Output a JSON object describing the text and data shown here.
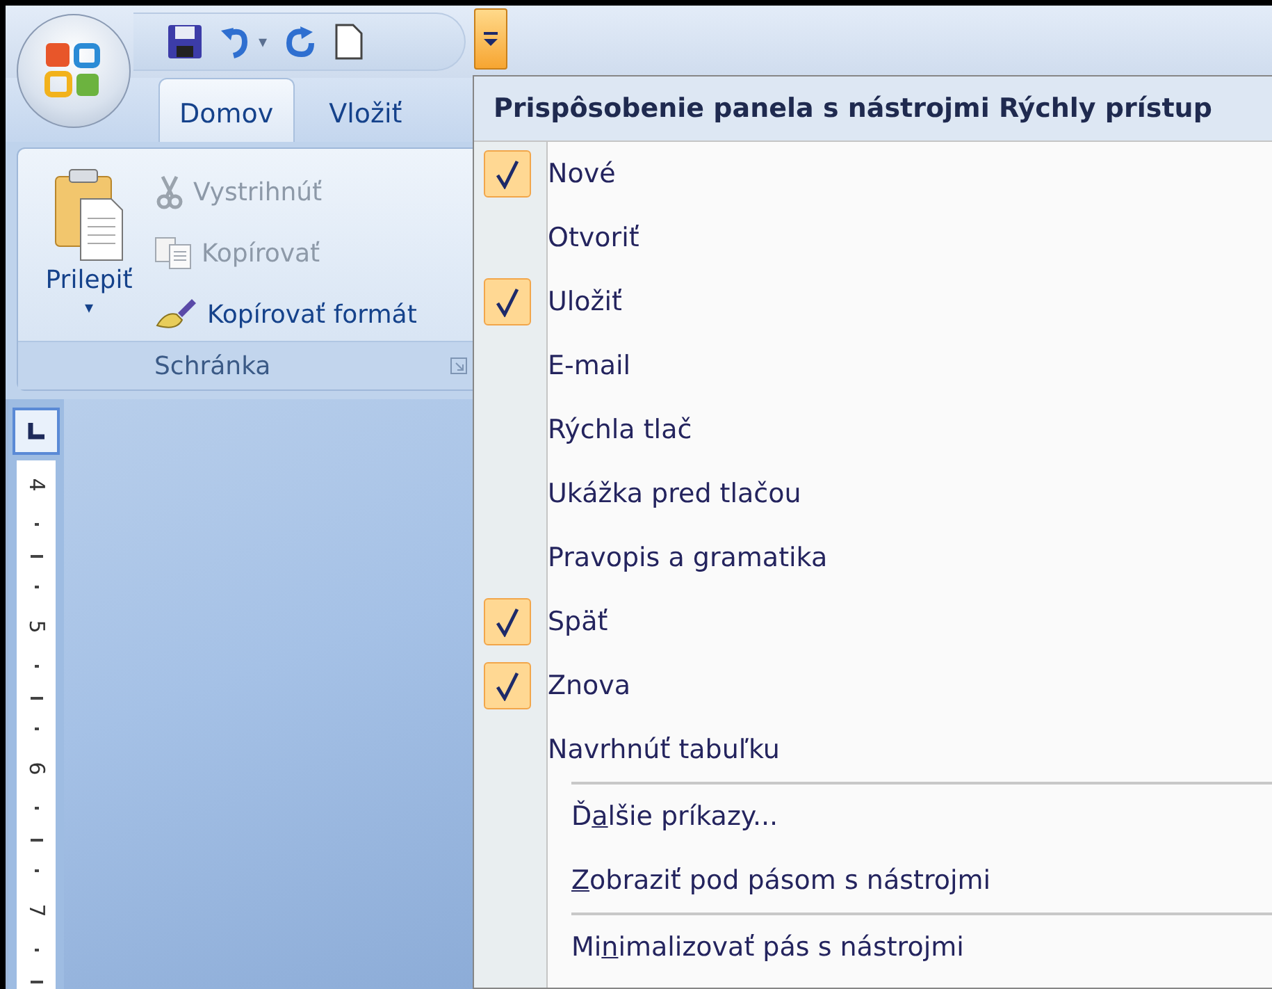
{
  "quick_access": {
    "undo_caret": "▾"
  },
  "ribbon": {
    "tabs": [
      {
        "label": "Domov",
        "selected": true
      },
      {
        "label": "Vložiť",
        "selected": false
      }
    ],
    "paste": {
      "label": "Prilepiť",
      "caret": "▾"
    },
    "commands": [
      {
        "kind": "cut",
        "label": "Vystrihnúť",
        "disabled": true
      },
      {
        "kind": "copy",
        "label": "Kopírovať",
        "disabled": true
      },
      {
        "kind": "brush",
        "label": "Kopírovať formát",
        "disabled": false
      }
    ],
    "group_label": "Schránka"
  },
  "ruler_labels": [
    "4",
    "5",
    "6",
    "7"
  ],
  "menu": {
    "title": "Prispôsobenie panela s nástrojmi Rýchly prístup",
    "items": [
      {
        "label": "Nové",
        "checked": true
      },
      {
        "label": "Otvoriť",
        "checked": false
      },
      {
        "label": "Uložiť",
        "checked": true
      },
      {
        "label": "E-mail",
        "checked": false
      },
      {
        "label": "Rýchla tlač",
        "checked": false
      },
      {
        "label": "Ukážka pred tlačou",
        "checked": false
      },
      {
        "label": "Pravopis a gramatika",
        "checked": false
      },
      {
        "label": "Späť",
        "checked": true
      },
      {
        "label": "Znova",
        "checked": true
      },
      {
        "label": "Navrhnúť tabuľku",
        "checked": false
      }
    ],
    "commands": [
      {
        "before": "Ď",
        "key": "a",
        "after": "lšie príkazy..."
      },
      {
        "key": "Z",
        "after": "obraziť pod pásom s nástrojmi"
      }
    ],
    "last_commands": [
      {
        "before": "Mi",
        "key": "n",
        "after": "imalizovať pás s nástrojmi"
      }
    ]
  }
}
